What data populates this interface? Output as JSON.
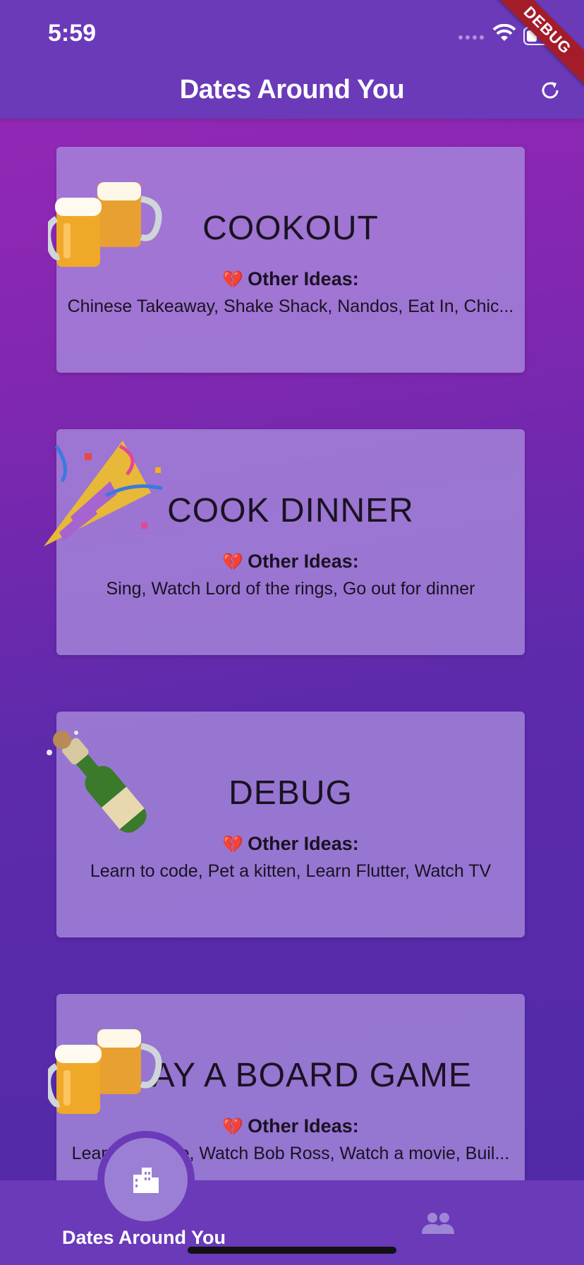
{
  "status_bar": {
    "time": "5:59"
  },
  "app_bar": {
    "title": "Dates Around You",
    "refresh_icon": "refresh-icon"
  },
  "debug_banner": "DEBUG",
  "cards": [
    {
      "title": "COOKOUT",
      "ideas_heading": "Other Ideas:",
      "ideas": "Chinese Takeaway, Shake Shack, Nandos, Eat In, Chic...",
      "emoji": "beer-mugs"
    },
    {
      "title": "COOK DINNER",
      "ideas_heading": "Other Ideas:",
      "ideas": "Sing, Watch Lord of the rings, Go out for dinner",
      "emoji": "party-popper"
    },
    {
      "title": "DEBUG",
      "ideas_heading": "Other Ideas:",
      "ideas": "Learn to code, Pet a kitten, Learn Flutter, Watch TV",
      "emoji": "champagne-bottle"
    },
    {
      "title": "PLAY A BOARD GAME",
      "ideas_heading": "Other Ideas:",
      "ideas": "Learn to dance, Watch Bob Ross, Watch a movie, Buil...",
      "emoji": "beer-mugs"
    }
  ],
  "bottom_nav": {
    "items": [
      {
        "label": "Dates Around You",
        "icon": "city-icon",
        "selected": true
      },
      {
        "label": "",
        "icon": "people-icon",
        "selected": false
      }
    ]
  },
  "colors": {
    "app_bar": "#6a3ab9",
    "card": "#a88cdc",
    "heart": "#d0203a",
    "debug": "#a41c2a"
  }
}
